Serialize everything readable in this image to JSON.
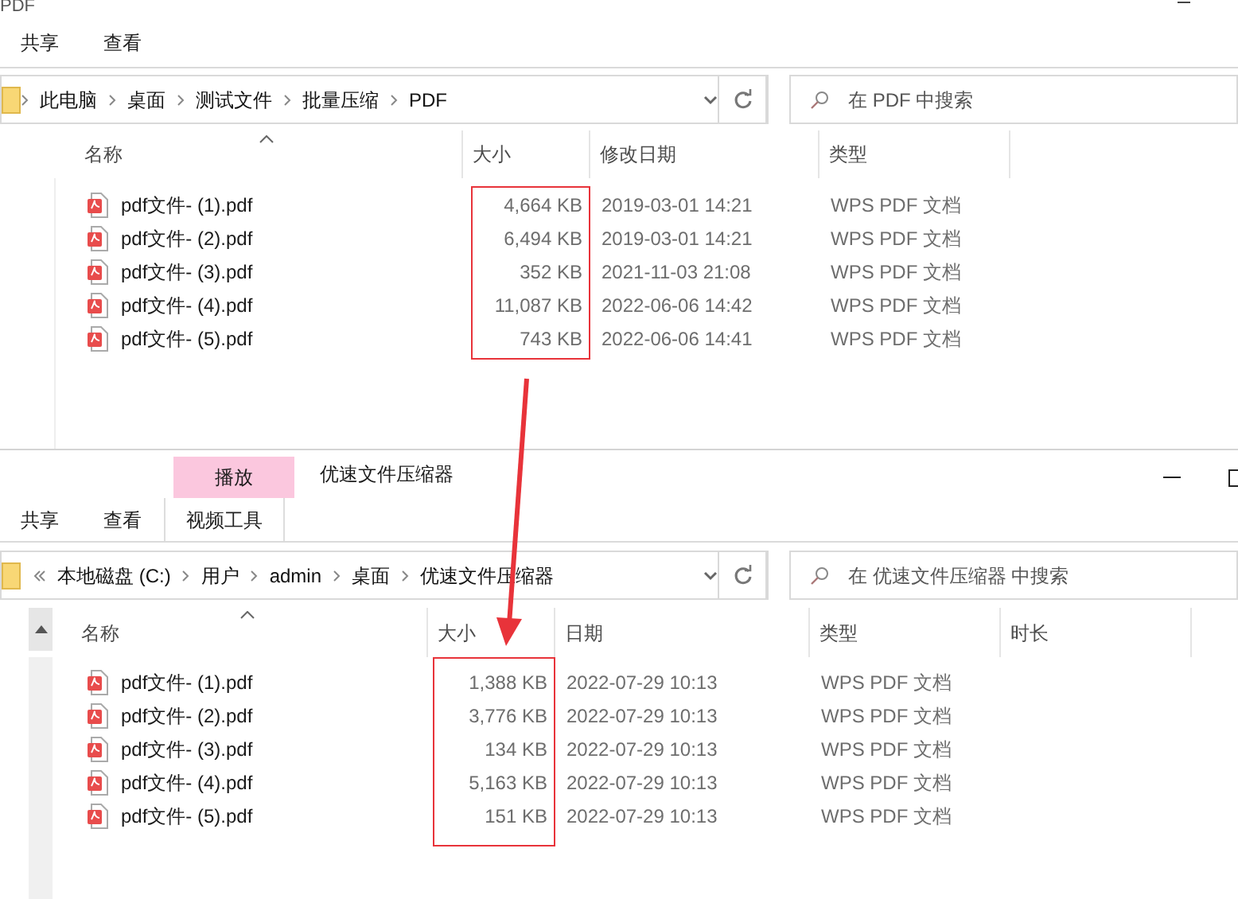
{
  "windows": [
    {
      "title": "PDF",
      "ribbon_tabs": [
        {
          "label": "共享",
          "kind": "normal"
        },
        {
          "label": "查看",
          "kind": "normal"
        }
      ],
      "path_truncated": false,
      "breadcrumb": [
        "此电脑",
        "桌面",
        "测试文件",
        "批量压缩",
        "PDF"
      ],
      "search": {
        "placeholder": "在 PDF 中搜索"
      },
      "columns": [
        {
          "label": "名称",
          "sorted": true,
          "highlighted": false
        },
        {
          "label": "大小",
          "sorted": false,
          "highlighted": true
        },
        {
          "label": "修改日期",
          "sorted": false,
          "highlighted": false
        },
        {
          "label": "类型",
          "sorted": false,
          "highlighted": false
        }
      ],
      "rows": [
        {
          "cells": [
            "pdf文件- (1).pdf",
            "4,664 KB",
            "2019-03-01 14:21",
            "WPS PDF 文档"
          ]
        },
        {
          "cells": [
            "pdf文件- (2).pdf",
            "6,494 KB",
            "2019-03-01 14:21",
            "WPS PDF 文档"
          ]
        },
        {
          "cells": [
            "pdf文件- (3).pdf",
            "352 KB",
            "2021-11-03 21:08",
            "WPS PDF 文档"
          ]
        },
        {
          "cells": [
            "pdf文件- (4).pdf",
            "11,087 KB",
            "2022-06-06 14:42",
            "WPS PDF 文档"
          ]
        },
        {
          "cells": [
            "pdf文件- (5).pdf",
            "743 KB",
            "2022-06-06 14:41",
            "WPS PDF 文档"
          ]
        }
      ]
    },
    {
      "title": "优速文件压缩器",
      "context_tab": "播放",
      "ribbon_tabs": [
        {
          "label": "共享",
          "kind": "normal"
        },
        {
          "label": "查看",
          "kind": "normal"
        },
        {
          "label": "视频工具",
          "kind": "context"
        }
      ],
      "path_truncated": true,
      "breadcrumb": [
        "本地磁盘 (C:)",
        "用户",
        "admin",
        "桌面",
        "优速文件压缩器"
      ],
      "search": {
        "placeholder": "在 优速文件压缩器 中搜索"
      },
      "columns": [
        {
          "label": "名称",
          "sorted": true,
          "highlighted": false
        },
        {
          "label": "大小",
          "sorted": false,
          "highlighted": true
        },
        {
          "label": "日期",
          "sorted": false,
          "highlighted": false
        },
        {
          "label": "类型",
          "sorted": false,
          "highlighted": false
        },
        {
          "label": "时长",
          "sorted": false,
          "highlighted": false
        }
      ],
      "rows": [
        {
          "cells": [
            "pdf文件- (1).pdf",
            "1,388 KB",
            "2022-07-29 10:13",
            "WPS PDF 文档"
          ]
        },
        {
          "cells": [
            "pdf文件- (2).pdf",
            "3,776 KB",
            "2022-07-29 10:13",
            "WPS PDF 文档"
          ]
        },
        {
          "cells": [
            "pdf文件- (3).pdf",
            "134 KB",
            "2022-07-29 10:13",
            "WPS PDF 文档"
          ]
        },
        {
          "cells": [
            "pdf文件- (4).pdf",
            "5,163 KB",
            "2022-07-29 10:13",
            "WPS PDF 文档"
          ]
        },
        {
          "cells": [
            "pdf文件- (5).pdf",
            "151 KB",
            "2022-07-29 10:13",
            "WPS PDF 文档"
          ]
        }
      ]
    }
  ]
}
